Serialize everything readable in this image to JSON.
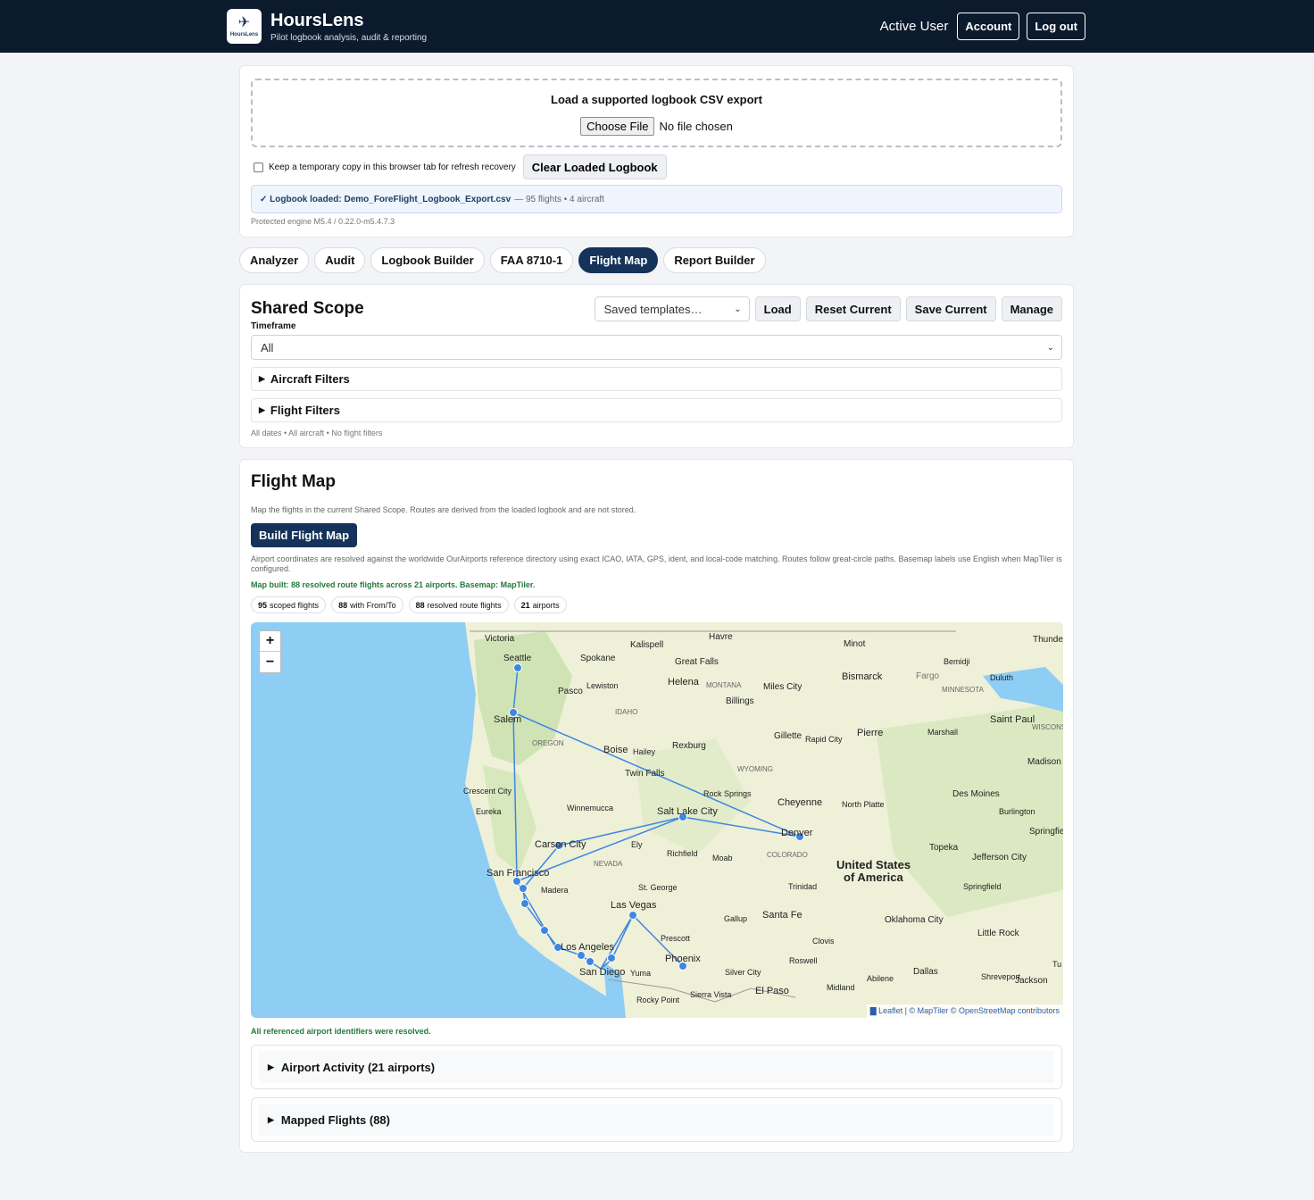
{
  "header": {
    "logo_text": "HoursLens",
    "title": "HoursLens",
    "subtitle": "Pilot logbook analysis, audit & reporting",
    "active_user": "Active User",
    "account_label": "Account",
    "logout_label": "Log out"
  },
  "upload": {
    "title": "Load a supported logbook CSV export",
    "choose_file_label": "Choose File",
    "no_file_text": "No file chosen",
    "keep_copy_label": "Keep a temporary copy in this browser tab for refresh recovery",
    "clear_label": "Clear Loaded Logbook",
    "loaded_text": "✓ Logbook loaded: Demo_ForeFlight_Logbook_Export.csv",
    "loaded_meta": "— 95 flights • 4 aircraft",
    "engine_text": "Protected engine M5.4 / 0.22.0-m5.4.7.3"
  },
  "tabs": [
    {
      "label": "Analyzer",
      "active": false
    },
    {
      "label": "Audit",
      "active": false
    },
    {
      "label": "Logbook Builder",
      "active": false
    },
    {
      "label": "FAA 8710-1",
      "active": false
    },
    {
      "label": "Flight Map",
      "active": true
    },
    {
      "label": "Report Builder",
      "active": false
    }
  ],
  "scope": {
    "title": "Shared Scope",
    "templates_placeholder": "Saved templates…",
    "load_label": "Load",
    "reset_label": "Reset Current",
    "save_label": "Save Current",
    "manage_label": "Manage",
    "timeframe_label": "Timeframe",
    "timeframe_value": "All",
    "aircraft_filters_label": "Aircraft Filters",
    "flight_filters_label": "Flight Filters",
    "summary": "All dates • All aircraft • No flight filters"
  },
  "flight_map": {
    "title": "Flight Map",
    "description": "Map the flights in the current Shared Scope. Routes are derived from the loaded logbook and are not stored.",
    "build_label": "Build Flight Map",
    "coord_note": "Airport coordinates are resolved against the worldwide OurAirports reference directory using exact ICAO, IATA, GPS, ident, and local-code matching. Routes follow great-circle paths. Basemap labels use English when MapTiler is configured.",
    "status": "Map built: 88 resolved route flights across 21 airports. Basemap: MapTiler.",
    "pills": [
      {
        "count": "95",
        "label": "scoped flights"
      },
      {
        "count": "88",
        "label": "with From/To"
      },
      {
        "count": "88",
        "label": "resolved route flights"
      },
      {
        "count": "21",
        "label": "airports"
      }
    ],
    "zoom_in": "+",
    "zoom_out": "−",
    "attribution": "▇ Leaflet | © MapTiler © OpenStreetMap contributors",
    "resolved_note": "All referenced airport identifiers were resolved.",
    "airport_activity_label": "Airport Activity (21 airports)",
    "mapped_flights_label": "Mapped Flights (88)"
  },
  "map_labels": {
    "victoria": "Victoria",
    "seattle": "Seattle",
    "kalispell": "Kalispell",
    "havre": "Havre",
    "minot": "Minot",
    "thunder_bay": "Thunder B",
    "spokane": "Spokane",
    "great_falls": "Great Falls",
    "bismarck": "Bismarck",
    "fargo": "Fargo",
    "bemidji": "Bemidji",
    "duluth": "Duluth",
    "pasco": "Pasco",
    "lewiston": "Lewiston",
    "helena": "Helena",
    "montana": "MONTANA",
    "miles_city": "Miles City",
    "minnesota": "MINNESOTA",
    "salem": "Salem",
    "idaho": "IDAHO",
    "billings": "Billings",
    "saint_paul": "Saint Paul",
    "wisconsin": "WISCONSIN",
    "oregon": "OREGON",
    "boise": "Boise",
    "hailey": "Hailey",
    "rexburg": "Rexburg",
    "gillette": "Gillette",
    "rapid_city": "Rapid City",
    "pierre": "Pierre",
    "marshall": "Marshall",
    "madison": "Madison",
    "twin_falls": "Twin Falls",
    "wyoming": "WYOMING",
    "rock_springs": "Rock Springs",
    "des_moines": "Des Moines",
    "crescent_city": "Crescent City",
    "eureka": "Eureka",
    "winnemucca": "Winnemucca",
    "salt_lake_city": "Salt Lake City",
    "cheyenne": "Cheyenne",
    "north_platte": "North Platte",
    "burlington": "Burlington",
    "springfield_il": "Springfield",
    "carson_city": "Carson City",
    "ely": "Ely",
    "denver": "Denver",
    "topeka": "Topeka",
    "jefferson_city": "Jefferson City",
    "nevada": "NEVADA",
    "richfield": "Richfield",
    "moab": "Moab",
    "colorado": "COLORADO",
    "united_states": "United States",
    "of_america": "of America",
    "san_francisco": "San Francisco",
    "madera": "Madera",
    "st_george": "St. George",
    "trinidad": "Trinidad",
    "springfield_mo": "Springfield",
    "las_vegas": "Las Vegas",
    "gallup": "Gallup",
    "santa_fe": "Santa Fe",
    "oklahoma_city": "Oklahoma City",
    "prescott": "Prescott",
    "clovis": "Clovis",
    "little_rock": "Little Rock",
    "los_angeles": "Los Angeles",
    "phoenix": "Phoenix",
    "roswell": "Roswell",
    "san_diego": "San Diego",
    "yuma": "Yuma",
    "silver_city": "Silver City",
    "dallas": "Dallas",
    "shreveport": "Shreveport",
    "abilene": "Abilene",
    "rocky_point": "Rocky Point",
    "sierra_vista": "Sierra Vista",
    "el_paso": "El Paso",
    "midland": "Midland",
    "jackson": "Jackson",
    "tu": "Tu"
  },
  "colors": {
    "header_bg": "#0c1a2e",
    "accent": "#15335a",
    "success": "#247a3c",
    "route": "#3f86e0",
    "water": "#8ecdf4"
  }
}
